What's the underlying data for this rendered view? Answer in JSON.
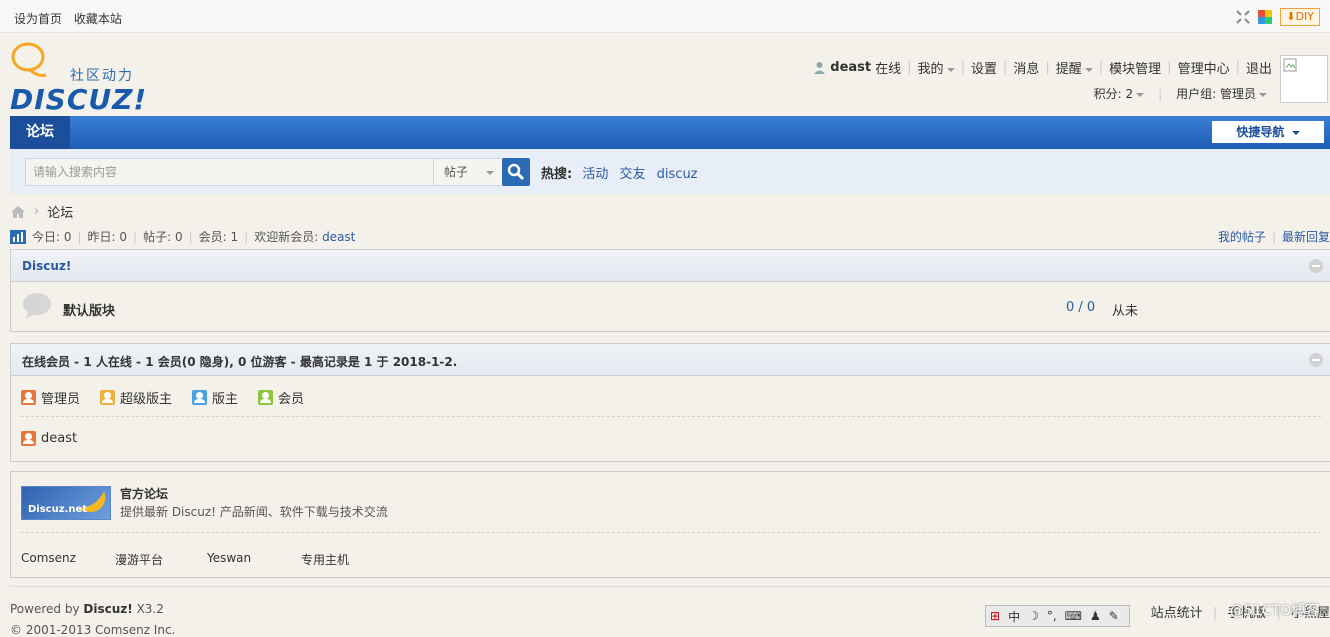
{
  "topbar": {
    "set_home": "设为首页",
    "bookmark": "收藏本站",
    "diy": "DIY"
  },
  "logo": {
    "slogan": "社区动力",
    "brand": "DISCUZ!"
  },
  "user": {
    "name": "deast",
    "online": "在线",
    "menu": [
      "我的",
      "设置",
      "消息",
      "提醒",
      "模块管理",
      "管理中心",
      "退出"
    ],
    "points": "积分: 2",
    "group": "用户组: 管理员"
  },
  "nav": {
    "tab": "论坛",
    "quick": "快捷导航"
  },
  "search": {
    "placeholder": "请输入搜索内容",
    "type": "帖子",
    "hot_label": "热搜:",
    "hot": [
      "活动",
      "交友",
      "discuz"
    ]
  },
  "breadcrumb": {
    "current": "论坛"
  },
  "stats": {
    "today": "今日: 0",
    "yesterday": "昨日: 0",
    "posts": "帖子: 0",
    "members": "会员: 1",
    "welcome": "欢迎新会员:",
    "new_member": "deast",
    "my_posts": "我的帖子",
    "latest": "最新回复"
  },
  "category": {
    "title": "Discuz!",
    "forum_name": "默认版块",
    "counts": "0 / 0",
    "last": "从未"
  },
  "online": {
    "title": "在线会员 - 1 人在线 - 1 会员(0 隐身), 0 位游客 - 最高记录是 1 于 2018-1-2.",
    "groups": [
      "管理员",
      "超级版主",
      "版主",
      "会员"
    ],
    "users": [
      "deast"
    ]
  },
  "links": {
    "title": "官方论坛",
    "desc": "提供最新 Discuz! 产品新闻、软件下载与技术交流",
    "logo_text": "Discuz.net",
    "items": [
      "Comsenz",
      "漫游平台",
      "Yeswan",
      "专用主机"
    ]
  },
  "footer": {
    "powered_prefix": "Powered by",
    "powered_brand": "Discuz!",
    "version": "X3.2",
    "copyright": "© 2001-2013 Comsenz Inc.",
    "right_links": [
      "站点统计",
      "手机版",
      "小黑屋"
    ]
  },
  "ime": {
    "label": "中"
  },
  "watermark": "@51CTO博客",
  "colors": {
    "nav_blue": "#1f5eb8",
    "link_blue": "#2b5aa0",
    "admin": "#e8743b",
    "supermod": "#f0b040",
    "mod": "#4aa3df",
    "member": "#8cc63f"
  }
}
